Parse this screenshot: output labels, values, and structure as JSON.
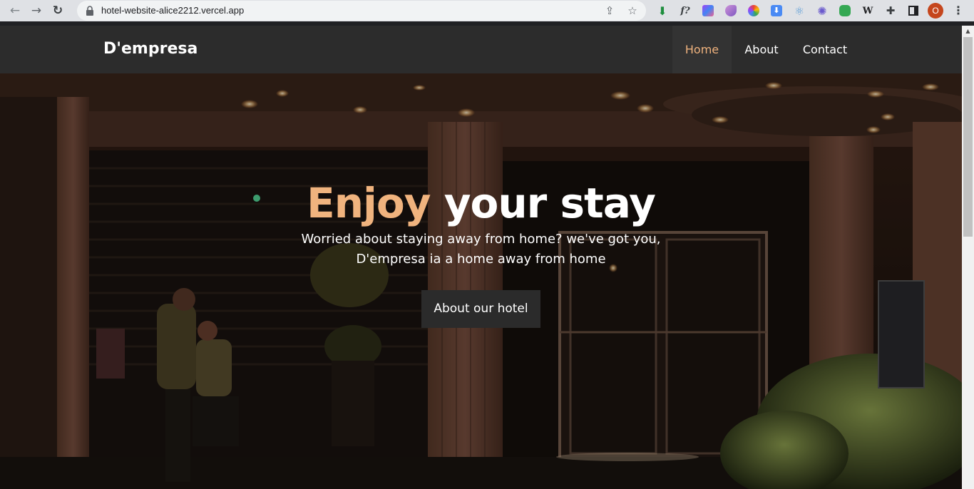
{
  "browser": {
    "url": "hotel-website-alice2212.vercel.app",
    "profile_initial": "O",
    "extensions": [
      "download-icon",
      "f?",
      "puzzle-piece-icon",
      "W"
    ]
  },
  "site": {
    "brand": "D'empresa",
    "nav": [
      {
        "label": "Home",
        "active": true
      },
      {
        "label": "About",
        "active": false
      },
      {
        "label": "Contact",
        "active": false
      }
    ],
    "accent_color": "#f0b37e"
  },
  "hero": {
    "headline_accent": "Enjoy",
    "headline_rest": " your stay",
    "subtitle_line1": "Worried about staying away from home? we've got you,",
    "subtitle_line2": "D'empresa ia a home away from home",
    "cta_label": "About our hotel"
  }
}
